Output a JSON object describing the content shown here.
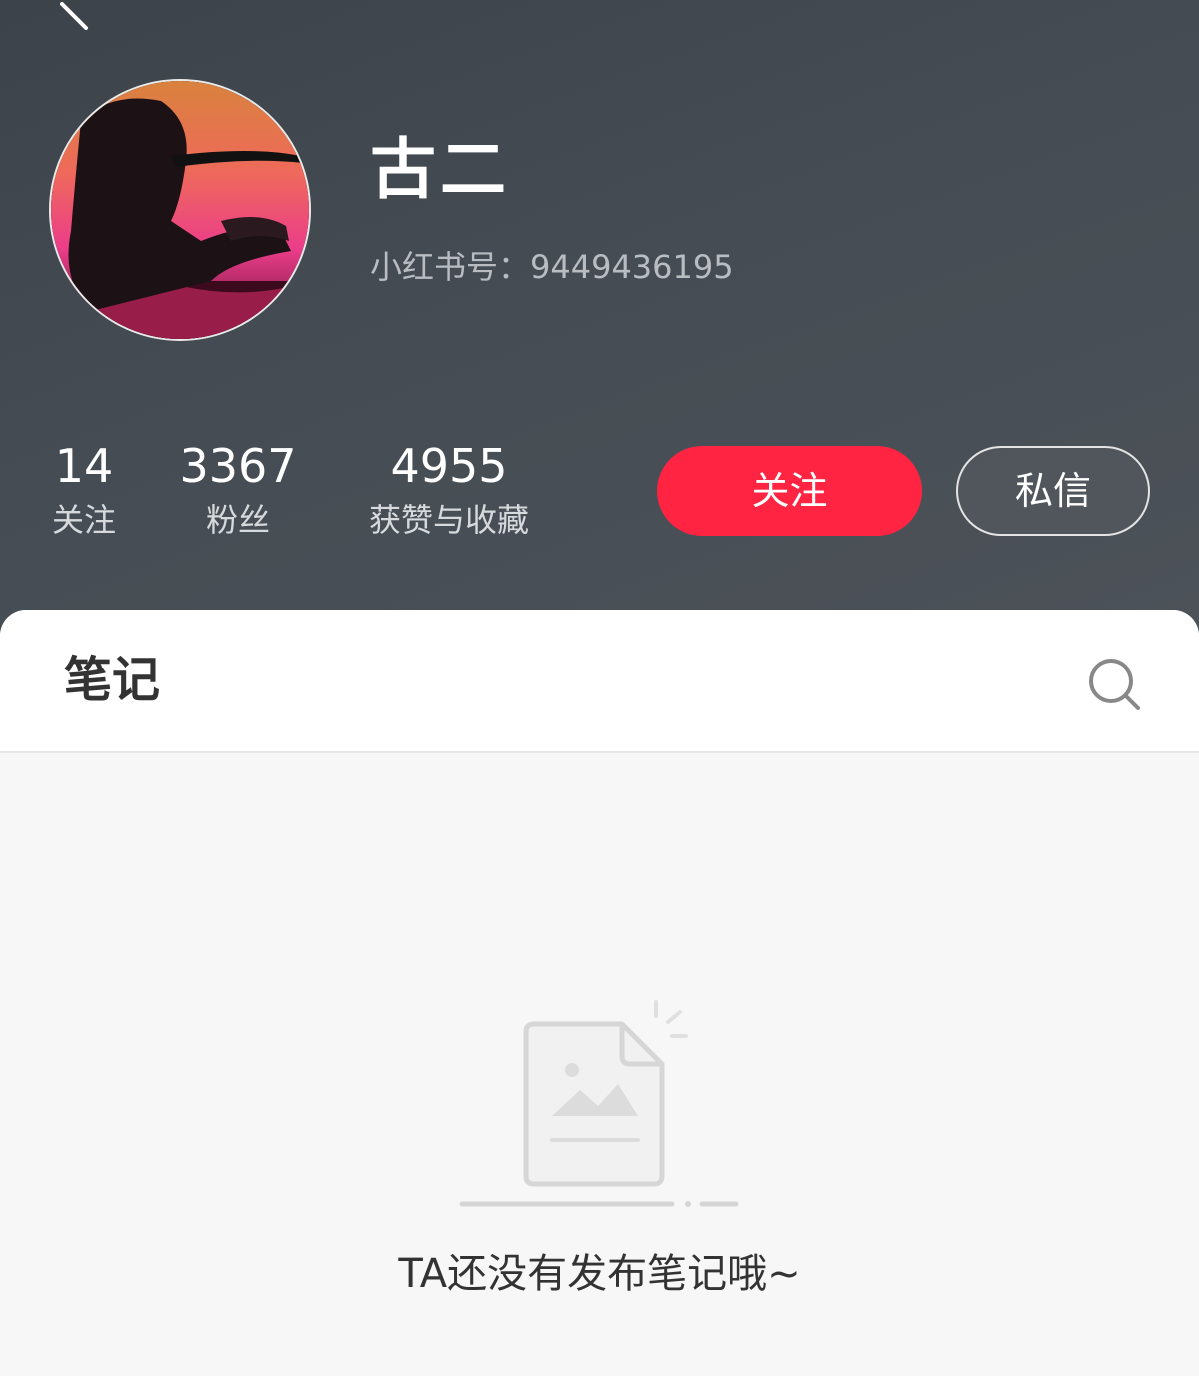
{
  "header": {
    "back_icon": "chevron-left-icon",
    "username": "古二",
    "user_id": "小红书号：9449436195",
    "stats": [
      {
        "value": "14",
        "label": "关注"
      },
      {
        "value": "3367",
        "label": "粉丝"
      },
      {
        "value": "4955",
        "label": "获赞与收藏"
      }
    ],
    "follow_label": "关注",
    "message_label": "私信"
  },
  "colors": {
    "accent": "#ff2442",
    "header_bg": "#454c53"
  },
  "content": {
    "tab_label": "笔记",
    "search_icon": "search-icon",
    "empty_icon": "empty-note-icon",
    "empty_text": "TA还没有发布笔记哦~"
  }
}
